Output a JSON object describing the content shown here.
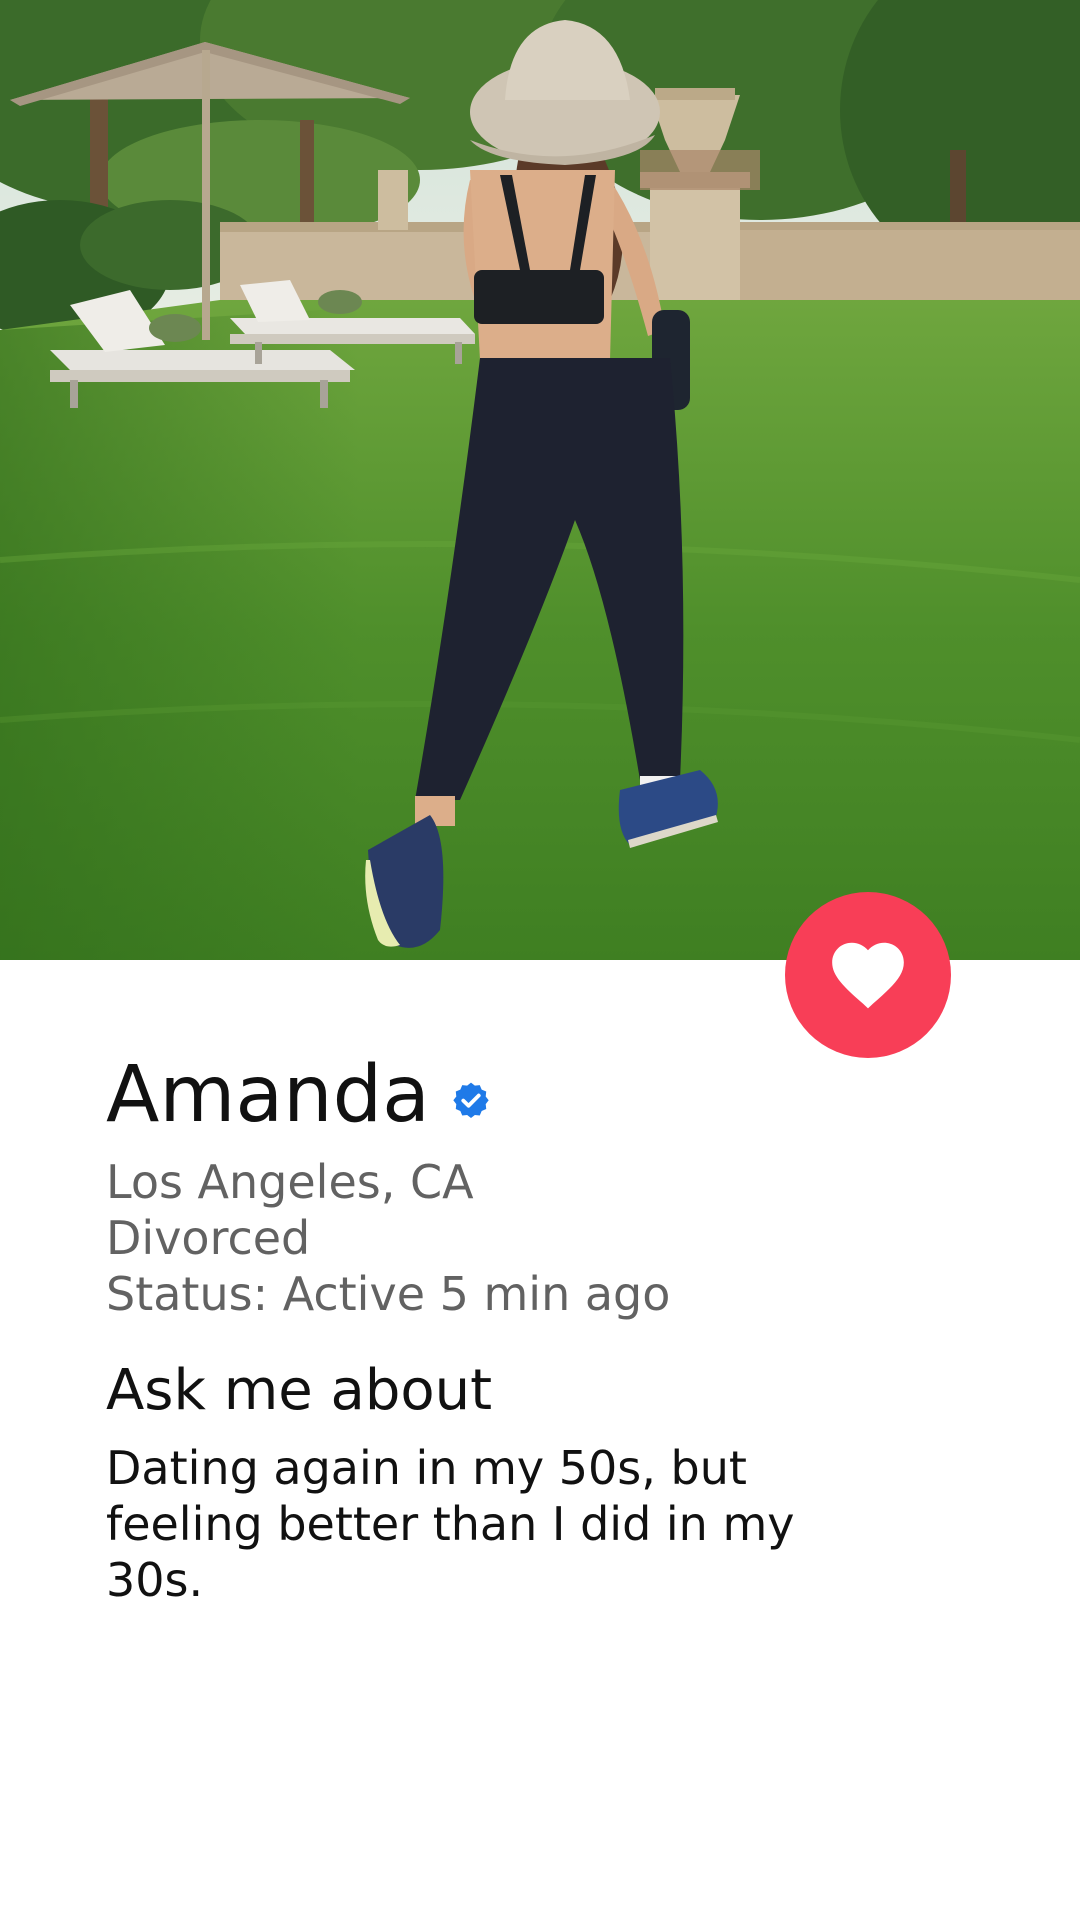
{
  "photo": {
    "icon": "profile-photo-woman-walking-on-lawn"
  },
  "like_button": {
    "icon": "heart-icon",
    "color": "#f83e57"
  },
  "profile": {
    "name": "Amanda",
    "verified_icon": "verified-badge-icon",
    "verified_color": "#1f7ae8",
    "location": "Los Angeles, CA",
    "relationship": "Divorced",
    "status": "Status: Active 5 min ago"
  },
  "ask_me": {
    "title": "Ask me about",
    "text": "Dating again in my 50s, but feeling better than I did in my 30s."
  }
}
